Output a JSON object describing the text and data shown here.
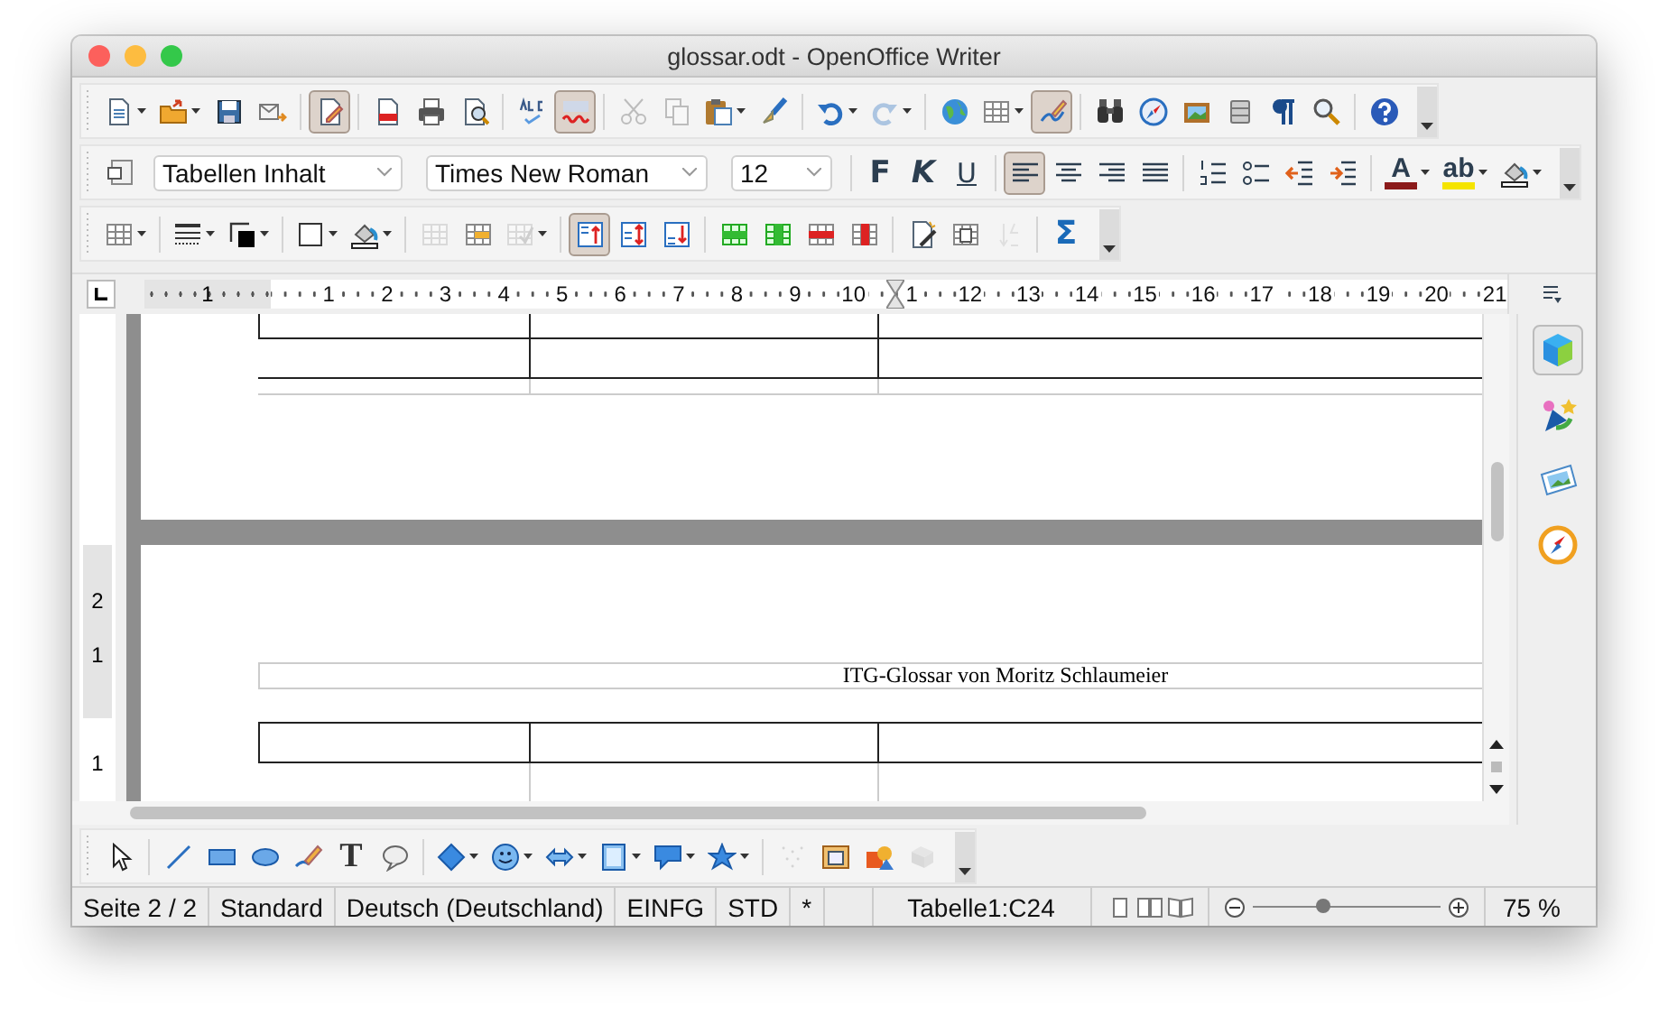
{
  "window": {
    "title": "glossar.odt - OpenOffice Writer"
  },
  "toolbars": [
    {
      "items": [
        {
          "kind": "button",
          "dropdown": true,
          "pressed": false,
          "disabled": false
        },
        {
          "kind": "button",
          "dropdown": true,
          "pressed": false,
          "disabled": false
        },
        {
          "kind": "button",
          "dropdown": false,
          "pressed": false,
          "disabled": false
        },
        {
          "kind": "button",
          "dropdown": false,
          "pressed": false,
          "disabled": false
        },
        {
          "kind": "button",
          "dropdown": false,
          "pressed": true,
          "disabled": false
        },
        {
          "kind": "button",
          "dropdown": false,
          "pressed": false,
          "disabled": false
        },
        {
          "kind": "button",
          "dropdown": false,
          "pressed": false,
          "disabled": false
        },
        {
          "kind": "button",
          "dropdown": false,
          "pressed": false,
          "disabled": false
        },
        {
          "kind": "button",
          "dropdown": false,
          "pressed": false,
          "disabled": false
        },
        {
          "kind": "button",
          "dropdown": false,
          "pressed": true,
          "disabled": false
        },
        {
          "kind": "button",
          "dropdown": false,
          "pressed": false,
          "disabled": true
        },
        {
          "kind": "button",
          "dropdown": false,
          "pressed": false,
          "disabled": true
        },
        {
          "kind": "button",
          "dropdown": true,
          "pressed": false,
          "disabled": false
        },
        {
          "kind": "button",
          "dropdown": false,
          "pressed": false,
          "disabled": false
        },
        {
          "kind": "button",
          "dropdown": true,
          "pressed": false,
          "disabled": false
        },
        {
          "kind": "button",
          "dropdown": true,
          "pressed": false,
          "disabled": true
        },
        {
          "kind": "button",
          "dropdown": false,
          "pressed": false,
          "disabled": false
        },
        {
          "kind": "button",
          "dropdown": true,
          "pressed": false,
          "disabled": false
        },
        {
          "kind": "button",
          "dropdown": false,
          "pressed": true,
          "disabled": false
        },
        {
          "kind": "button",
          "dropdown": false,
          "pressed": false,
          "disabled": false
        },
        {
          "kind": "button",
          "dropdown": false,
          "pressed": false,
          "disabled": false
        },
        {
          "kind": "button",
          "dropdown": false,
          "pressed": false,
          "disabled": false
        },
        {
          "kind": "button",
          "dropdown": false,
          "pressed": false,
          "disabled": false
        },
        {
          "kind": "button",
          "dropdown": false,
          "pressed": false,
          "disabled": false
        },
        {
          "kind": "button",
          "dropdown": false,
          "pressed": false,
          "disabled": false
        },
        {
          "kind": "button",
          "dropdown": false,
          "pressed": false,
          "disabled": false
        },
        {
          "kind": "overflow"
        }
      ]
    },
    {
      "items": [
        {
          "kind": "button",
          "dropdown": false,
          "pressed": false,
          "disabled": false
        },
        {
          "kind": "combo",
          "value": "Tabellen Inhalt"
        },
        {
          "kind": "combo",
          "value": "Times New Roman"
        },
        {
          "kind": "combo",
          "value": "12"
        },
        {
          "kind": "text",
          "text": "F",
          "pressed": false
        },
        {
          "kind": "text",
          "text": "K",
          "pressed": false
        },
        {
          "kind": "text",
          "text": "U",
          "pressed": false
        },
        {
          "kind": "button",
          "dropdown": false,
          "pressed": true,
          "disabled": false
        },
        {
          "kind": "button",
          "dropdown": false,
          "pressed": false,
          "disabled": false
        },
        {
          "kind": "button",
          "dropdown": false,
          "pressed": false,
          "disabled": false
        },
        {
          "kind": "button",
          "dropdown": false,
          "pressed": false,
          "disabled": false
        },
        {
          "kind": "button",
          "dropdown": false,
          "pressed": false,
          "disabled": false
        },
        {
          "kind": "button",
          "dropdown": false,
          "pressed": false,
          "disabled": false
        },
        {
          "kind": "button",
          "dropdown": false,
          "pressed": false,
          "disabled": false
        },
        {
          "kind": "button",
          "dropdown": false,
          "pressed": false,
          "disabled": false
        },
        {
          "kind": "color",
          "text": "A",
          "color": "#8b1a1a"
        },
        {
          "kind": "color",
          "text": "ab",
          "color": "#f5e400"
        },
        {
          "kind": "button",
          "dropdown": true,
          "pressed": false,
          "disabled": false
        },
        {
          "kind": "overflow"
        }
      ]
    },
    {
      "items": [
        {
          "kind": "button",
          "dropdown": true,
          "pressed": false,
          "disabled": false
        },
        {
          "kind": "button",
          "dropdown": true,
          "pressed": false,
          "disabled": false
        },
        {
          "kind": "button",
          "dropdown": true,
          "pressed": false,
          "disabled": false
        },
        {
          "kind": "button",
          "dropdown": true,
          "pressed": false,
          "disabled": false
        },
        {
          "kind": "button",
          "dropdown": true,
          "pressed": false,
          "disabled": false
        },
        {
          "kind": "button",
          "dropdown": false,
          "pressed": false,
          "disabled": true
        },
        {
          "kind": "button",
          "dropdown": false,
          "pressed": false,
          "disabled": false
        },
        {
          "kind": "button",
          "dropdown": true,
          "pressed": false,
          "disabled": true
        },
        {
          "kind": "button",
          "dropdown": false,
          "pressed": true,
          "disabled": false
        },
        {
          "kind": "button",
          "dropdown": false,
          "pressed": false,
          "disabled": false
        },
        {
          "kind": "button",
          "dropdown": false,
          "pressed": false,
          "disabled": false
        },
        {
          "kind": "button",
          "dropdown": false,
          "pressed": false,
          "disabled": false
        },
        {
          "kind": "button",
          "dropdown": false,
          "pressed": false,
          "disabled": false
        },
        {
          "kind": "button",
          "dropdown": false,
          "pressed": false,
          "disabled": false
        },
        {
          "kind": "button",
          "dropdown": false,
          "pressed": false,
          "disabled": false
        },
        {
          "kind": "button",
          "dropdown": false,
          "pressed": false,
          "disabled": false
        },
        {
          "kind": "button",
          "dropdown": false,
          "pressed": false,
          "disabled": false
        },
        {
          "kind": "button",
          "dropdown": false,
          "pressed": false,
          "disabled": true
        },
        {
          "kind": "text",
          "text": "Σ",
          "pressed": false
        },
        {
          "kind": "overflow"
        }
      ]
    }
  ],
  "ruler": {
    "labels": [
      "1",
      "1",
      "2",
      "3",
      "4",
      "5",
      "6",
      "7",
      "8",
      "9",
      "10",
      "1",
      "12",
      "13",
      "14",
      "15",
      "16",
      "17",
      "18",
      "19",
      "20",
      "21"
    ]
  },
  "vertical_ruler": {
    "labels": [
      "2",
      "1",
      "1"
    ]
  },
  "document": {
    "header_text": "ITG-Glossar von Moritz Schlaumeier"
  },
  "sidebar": {
    "decks": [
      {
        "selected": true
      },
      {
        "selected": false
      },
      {
        "selected": false
      },
      {
        "selected": false
      }
    ]
  },
  "drawing_toolbar": {
    "items": [
      {
        "kind": "button",
        "dropdown": false,
        "disabled": false
      },
      {
        "kind": "button",
        "dropdown": false,
        "disabled": false
      },
      {
        "kind": "button",
        "dropdown": false,
        "disabled": false
      },
      {
        "kind": "button",
        "dropdown": false,
        "disabled": false
      },
      {
        "kind": "button",
        "dropdown": false,
        "disabled": false
      },
      {
        "kind": "text",
        "text": "T",
        "pressed": false
      },
      {
        "kind": "button",
        "dropdown": false,
        "disabled": false
      },
      {
        "kind": "button",
        "dropdown": true,
        "disabled": false
      },
      {
        "kind": "button",
        "dropdown": true,
        "disabled": false
      },
      {
        "kind": "button",
        "dropdown": true,
        "disabled": false
      },
      {
        "kind": "button",
        "dropdown": true,
        "disabled": false
      },
      {
        "kind": "button",
        "dropdown": true,
        "disabled": false
      },
      {
        "kind": "button",
        "dropdown": true,
        "disabled": false
      },
      {
        "kind": "button",
        "dropdown": false,
        "disabled": true
      },
      {
        "kind": "button",
        "dropdown": false,
        "disabled": false
      },
      {
        "kind": "button",
        "dropdown": false,
        "disabled": false
      },
      {
        "kind": "button",
        "dropdown": false,
        "disabled": true
      },
      {
        "kind": "overflow"
      }
    ]
  },
  "status_bar": {
    "fields": [
      "Seite 2 / 2",
      "Standard",
      "Deutsch (Deutschland)",
      "EINFG",
      "STD",
      "*"
    ],
    "cell": "Tabelle1:C24",
    "view_layouts": [
      {
        "selected": false
      },
      {
        "selected": false
      },
      {
        "selected": false
      }
    ],
    "zoom": {
      "level": 0.38
    },
    "zoom_text": "75 %"
  }
}
